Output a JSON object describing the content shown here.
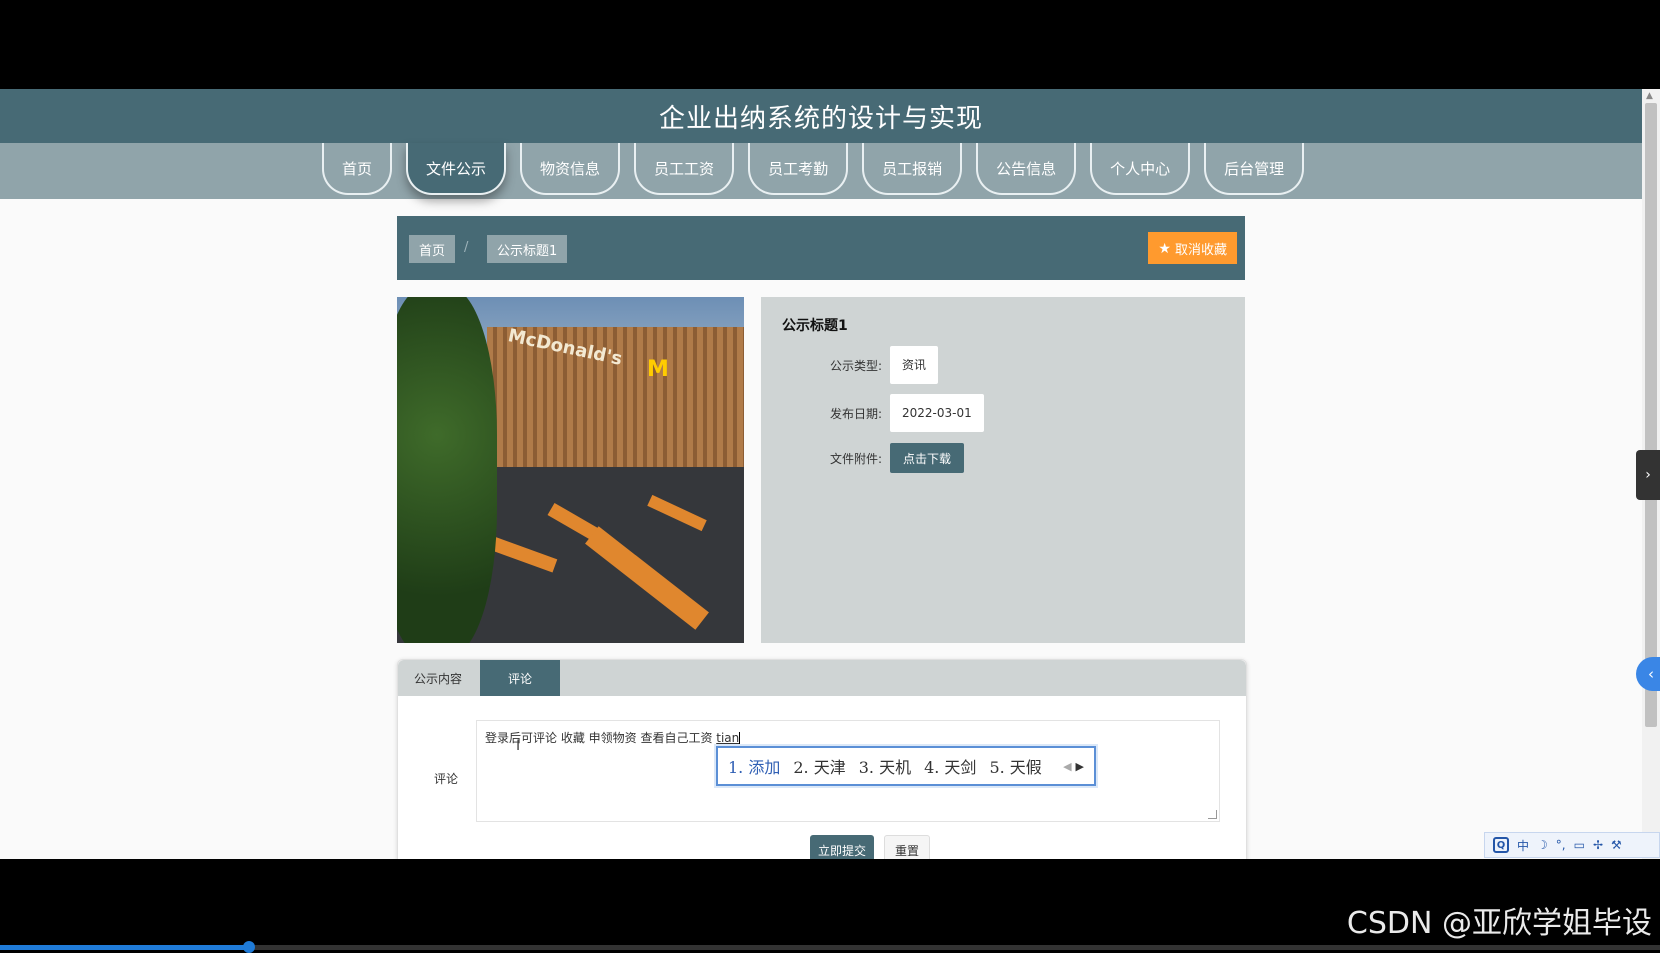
{
  "header": {
    "title": "企业出纳系统的设计与实现"
  },
  "nav": {
    "items": [
      {
        "label": "首页"
      },
      {
        "label": "文件公示"
      },
      {
        "label": "物资信息"
      },
      {
        "label": "员工工资"
      },
      {
        "label": "员工考勤"
      },
      {
        "label": "员工报销"
      },
      {
        "label": "公告信息"
      },
      {
        "label": "个人中心"
      },
      {
        "label": "后台管理"
      }
    ],
    "active_index": 1
  },
  "breadcrumb": {
    "home": "首页",
    "separator": "/",
    "current": "公示标题1",
    "unfavorite_label": "取消收藏"
  },
  "detail": {
    "title": "公示标题1",
    "type_label": "公示类型:",
    "type_value": "资讯",
    "date_label": "发布日期:",
    "date_value": "2022-03-01",
    "attachment_label": "文件附件:",
    "download_label": "点击下载",
    "photo_sign": "McDonald's",
    "photo_logo": "M"
  },
  "tabs": {
    "items": [
      {
        "label": "公示内容"
      },
      {
        "label": "评论"
      }
    ],
    "active_index": 1
  },
  "comment": {
    "label": "评论",
    "text": "登录后可评论 收藏 申领物资  查看自己工资 ",
    "composition": "tian",
    "submit_label": "立即提交",
    "reset_label": "重置"
  },
  "ime": {
    "candidates": [
      "1. 添加",
      "2. 天津",
      "3. 天机",
      "4. 天剑",
      "5. 天假"
    ],
    "toolbar_logo": "Q",
    "toolbar_mode": "中"
  },
  "watermark": "CSDN @亚欣学姐毕设",
  "video_progress": 0.15,
  "colors": {
    "primary": "#476a75",
    "nav_bg": "#90a4aa",
    "accent": "#ff9a2e",
    "panel_bg": "#cfd4d4"
  }
}
